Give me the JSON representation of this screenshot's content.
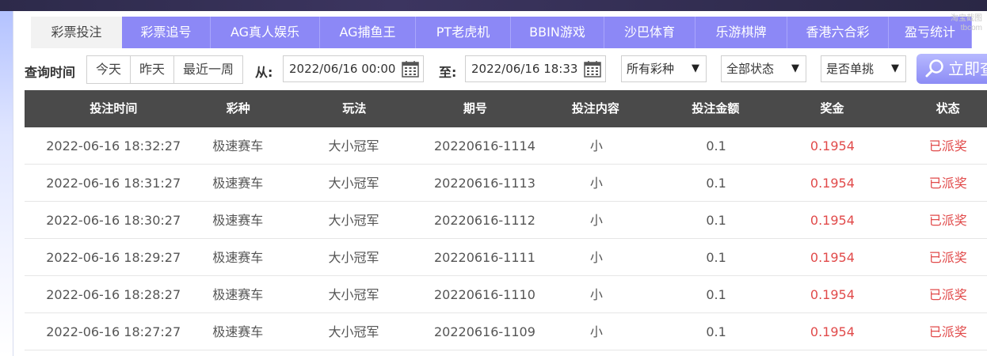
{
  "tabs": [
    {
      "label": "彩票投注",
      "active": true
    },
    {
      "label": "彩票追号",
      "active": false
    },
    {
      "label": "AG真人娱乐",
      "active": false
    },
    {
      "label": "AG捕鱼王",
      "active": false
    },
    {
      "label": "PT老虎机",
      "active": false
    },
    {
      "label": "BBIN游戏",
      "active": false
    },
    {
      "label": "沙巴体育",
      "active": false
    },
    {
      "label": "乐游棋牌",
      "active": false
    },
    {
      "label": "香港六合彩",
      "active": false
    },
    {
      "label": "盈亏统计",
      "active": false
    }
  ],
  "watermark": {
    "line1": "淘宝截图",
    "line2": "tbcom"
  },
  "filters": {
    "query_label": "查询时间",
    "quick": [
      "今天",
      "昨天",
      "最近一周"
    ],
    "from_label": "从:",
    "from_value": "2022/06/16 00:00",
    "to_label": "至:",
    "to_value": "2022/06/16 18:33",
    "lottery_select": "所有彩种",
    "status_select": "全部状态",
    "single_select": "是否单挑",
    "search_label": "立即查询",
    "arrow_glyph": "▼"
  },
  "table": {
    "columns": [
      "投注时间",
      "彩种",
      "玩法",
      "期号",
      "投注内容",
      "投注金额",
      "奖金",
      "状态"
    ],
    "rows": [
      {
        "time": "2022-06-16 18:32:27",
        "lottery": "极速赛车",
        "play": "大小冠军",
        "issue": "20220616-1114",
        "content": "小",
        "amount": "0.1",
        "prize": "0.1954",
        "status": "已派奖"
      },
      {
        "time": "2022-06-16 18:31:27",
        "lottery": "极速赛车",
        "play": "大小冠军",
        "issue": "20220616-1113",
        "content": "小",
        "amount": "0.1",
        "prize": "0.1954",
        "status": "已派奖"
      },
      {
        "time": "2022-06-16 18:30:27",
        "lottery": "极速赛车",
        "play": "大小冠军",
        "issue": "20220616-1112",
        "content": "小",
        "amount": "0.1",
        "prize": "0.1954",
        "status": "已派奖"
      },
      {
        "time": "2022-06-16 18:29:27",
        "lottery": "极速赛车",
        "play": "大小冠军",
        "issue": "20220616-1111",
        "content": "小",
        "amount": "0.1",
        "prize": "0.1954",
        "status": "已派奖"
      },
      {
        "time": "2022-06-16 18:28:27",
        "lottery": "极速赛车",
        "play": "大小冠军",
        "issue": "20220616-1110",
        "content": "小",
        "amount": "0.1",
        "prize": "0.1954",
        "status": "已派奖"
      },
      {
        "time": "2022-06-16 18:27:27",
        "lottery": "极速赛车",
        "play": "大小冠军",
        "issue": "20220616-1109",
        "content": "小",
        "amount": "0.1",
        "prize": "0.1954",
        "status": "已派奖"
      }
    ]
  },
  "colors": {
    "tab_bg": "#8c88f6",
    "header_bg": "#4a4a4a",
    "prize_red": "#e14a4a"
  }
}
